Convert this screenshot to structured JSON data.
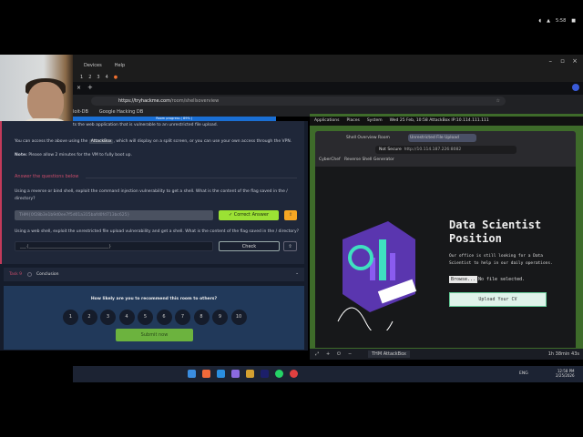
{
  "host_menu": [
    "Devices",
    "Help"
  ],
  "workspaces": [
    "1",
    "2",
    "3",
    "4"
  ],
  "tray_time": "5:58",
  "browser": {
    "url_host": "https://tryhackme.com",
    "url_path": "/room/shellsoverview",
    "bookmarks": [
      "loit-DB",
      "Google Hacking DB"
    ],
    "progress_label": "Room progress ( 89% )",
    "progress": 0.89
  },
  "content": {
    "intro_line1": "ts the web application that is vulnerable to an unrestricted file upload.",
    "access_pre": "You can access the above using the",
    "attackbox": "AttackBox",
    "access_post": ", which will display on a split screen, or you can use your own access through the VPN.",
    "note_label": "Note:",
    "note": "Please allow 2 minutes for the VM to fully boot up.",
    "answer_heading": "Answer the questions below",
    "q1": "Using a reverse or bind shell, exploit the command injection vulnerability to get a shell. What is the content of the flag saved in the /",
    "q1b": "directory?",
    "a1": "THM{0f28b3e1b9d0ee7f5d01a315bafd0fd713bc625}",
    "correct_label": "✓ Correct Answer",
    "q2": "Using a web shell, exploit the unrestricted file upload vulnerability and get a shell. What is the content of the flag saved in the / directory?",
    "a2_placeholder": "___{_______________________________________}",
    "check_label": "Check",
    "task_label": "Task 9",
    "task_title": "Conclusion",
    "rate_question": "How likely are you to recommend this room to others?",
    "ratings": [
      "1",
      "2",
      "3",
      "4",
      "5",
      "6",
      "7",
      "8",
      "9",
      "10"
    ],
    "submit_label": "Submit now"
  },
  "vm": {
    "menu": [
      "Applications",
      "Places",
      "System"
    ],
    "clock": "Wed 25 Feb, 10:58 AttackBox IP:10.114.111.111",
    "tabs": [
      "Shell Overview Room",
      "Unrestricted File Upload"
    ],
    "not_secure": "Not Secure",
    "url": "http://10.114.187.226:8082",
    "bookmarks": [
      "CyberChef",
      "Reverse Shell Generator"
    ],
    "title": "Data Scientist Position",
    "desc": "Our office is still looking for a Data Scientist to help in our daily operations.",
    "browse": "Browse...",
    "no_file": "No file selected.",
    "upload": "Upload Your CV",
    "machine": "THM AttackBox",
    "timer": "1h 38min 43s"
  },
  "taskbar": {
    "time": "12:58 PM",
    "date": "2/25/2026",
    "lang": "ENG"
  }
}
